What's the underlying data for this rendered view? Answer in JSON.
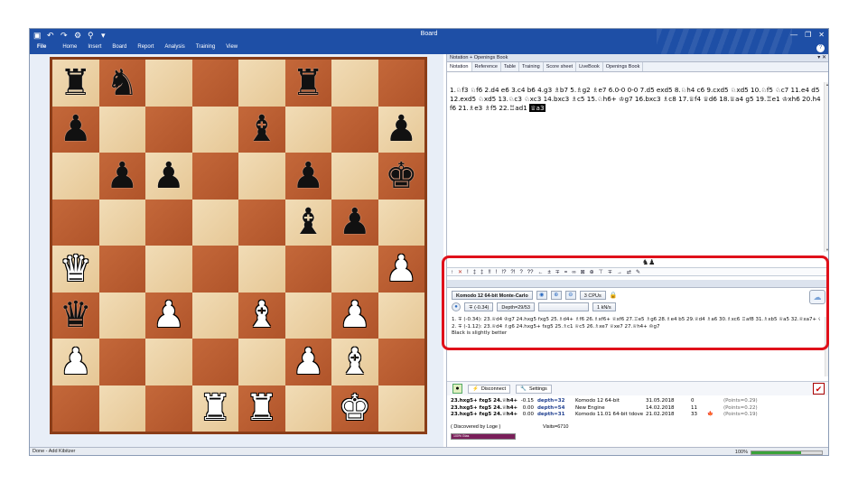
{
  "window": {
    "title": "Board"
  },
  "ribbon": {
    "file": "File",
    "menu": [
      "Home",
      "Insert",
      "Board",
      "Report",
      "Analysis",
      "Training",
      "View"
    ]
  },
  "board": {
    "rows": [
      [
        "bR",
        "bN",
        "",
        "",
        "",
        "bR",
        "",
        ""
      ],
      [
        "bP",
        "",
        "",
        "",
        "bB",
        "",
        "",
        "bP"
      ],
      [
        "",
        "bP",
        "bP",
        "",
        "",
        "bP",
        "",
        "bK"
      ],
      [
        "",
        "",
        "",
        "",
        "",
        "bB",
        "bP",
        ""
      ],
      [
        "wQ",
        "",
        "",
        "",
        "",
        "",
        "",
        "wP"
      ],
      [
        "bQ",
        "",
        "wP",
        "",
        "wB",
        "",
        "wP",
        ""
      ],
      [
        "wP",
        "",
        "",
        "",
        "",
        "wP",
        "wB",
        ""
      ],
      [
        "",
        "",
        "",
        "wR",
        "wR",
        "",
        "wK",
        ""
      ]
    ]
  },
  "nav_buttons": [
    "⇤",
    "←",
    "↶",
    "→",
    "⇥"
  ],
  "notation_panel": {
    "title": "Notation + Openings Book",
    "tabs": [
      "Notation",
      "Reference",
      "Table",
      "Training",
      "Score sheet",
      "LiveBook",
      "Openings Book"
    ],
    "moves_text": "1.♘f3 ♘f6 2.d4 e6 3.c4 b6 4.g3 ♗b7 5.♗g2 ♗e7 6.0-0 0-0 7.d5 exd5 8.♘h4 c6 9.cxd5 ♘xd5 10.♘f5 ♘c7 11.e4 d5 12.exd5 ♘xd5 13.♘c3 ♘xc3 14.bxc3 ♗c5 15.♘h6+ ♔g7 16.bxc3 ♗c8 17.♕f4 ♕d6 18.♕a4 g5 19.♖e1 ♔xh6 20.h4 f6 21.♗e3 ♗f5 22.♖ad1",
    "last_move": "♕a3"
  },
  "annotation_bar": [
    "↑",
    "✕",
    "!",
    "‡",
    "‡",
    "!!",
    "!",
    "!?",
    "?!",
    "?",
    "??",
    "←",
    "±",
    "∓",
    "=",
    "∞",
    "⊠",
    "⊕",
    "⊤",
    "∓",
    "→",
    "⇄",
    "✎"
  ],
  "engine": {
    "name": "Komodo 12 64-bit Monte-Carlo",
    "cpus": "3 CPUs",
    "eval": "∓ (-0.34)",
    "depth": "Depth=29/53",
    "speed": "1 kN/s",
    "lines": [
      "1. ∓ (-0.34): 23.♕d4 ♔g7 24.hxg5 fxg5 25.♗d4+ ♗f6 26.♗xf6+ ♕xf6 27.♖e5 ♗g6 28.♗e4 b5 29.♕d4 ♗a6 30.♗xc6 ♖af8 31.♗xb5 ♕a5 32.♕xa7+ ♔h8 33.♕d4",
      "2. ∓ (-1.12): 23.♕d4 ♗g6 24.hxg5+ fxg5 25.♗c1 ♕c5 26.♗xe7 ♕xe7 27.♕h4+ ♔g7",
      "Black is slightly better"
    ]
  },
  "kibitzer": {
    "disconnect": "Disconnect",
    "settings": "Settings",
    "rows": [
      {
        "line": "23.hxg5+ fxg5 24.♕h4+",
        "score": "-0.15",
        "depth": "depth=32",
        "engine": "Komodo 12 64-bit",
        "date": "31.05.2018",
        "n": "0",
        "flag": "",
        "points": "(Points=0.29)"
      },
      {
        "line": "23.hxg5+ fxg5 24.♕h4+",
        "score": "0.00",
        "depth": "depth=54",
        "engine": "New Engine",
        "date": "14.02.2018",
        "n": "11",
        "flag": "",
        "points": "(Points=0.22)"
      },
      {
        "line": "23.hxg5+ fxg5 24.♕h4+",
        "score": "0.00",
        "depth": "depth=31",
        "engine": "Komodo 11.01 64-bit tdove",
        "date": "21.02.2018",
        "n": "33",
        "flag": "🍁",
        "points": "(Points=0.19)"
      }
    ],
    "discovered": "( Discovered by Loge )",
    "visits": "Visits=6710",
    "progress_label": "100% Gtas",
    "progress": 1.0
  },
  "status": {
    "text": "Done - Add Kibitzer",
    "zoom": "100%",
    "zoom_level": 0.7
  }
}
